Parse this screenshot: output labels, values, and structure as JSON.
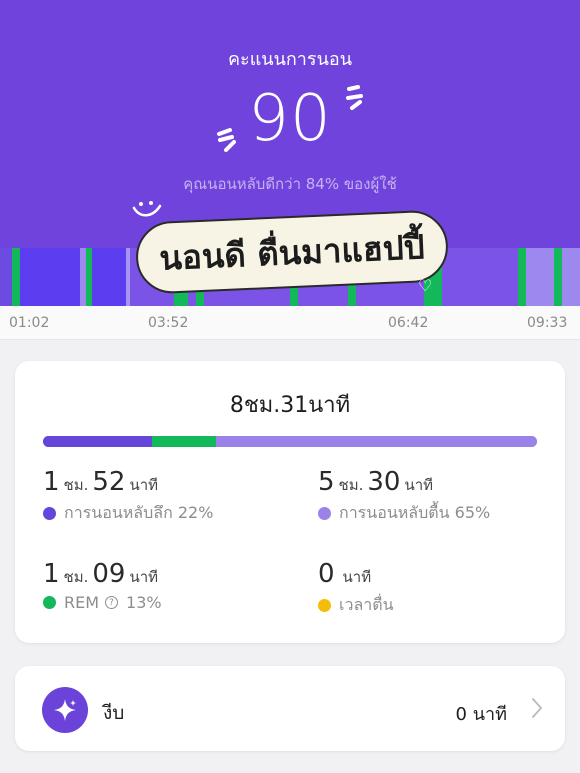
{
  "header": {
    "title": "คะแนนการนอน",
    "score": "90",
    "subtitle": "คุณนอนหลับดีกว่า 84% ของผู้ใช้"
  },
  "sticker": {
    "text": "นอนดี ตื่นมาแฮปปี้"
  },
  "axis": {
    "labels": [
      "01:02",
      "03:52",
      "06:42",
      "09:33"
    ]
  },
  "summary": {
    "total_hours": "8",
    "total_h_unit": "ชม.",
    "total_minutes": "31",
    "total_m_unit": "นาที",
    "proportions": {
      "deep": 0.22,
      "rem": 0.13,
      "light": 0.65
    },
    "stats": [
      {
        "hours": "1",
        "minutes": "52",
        "h_unit": "ชม.",
        "m_unit": "นาที",
        "label": "การนอนหลับลึก 22%",
        "color": "#6446d8"
      },
      {
        "hours": "5",
        "minutes": "30",
        "h_unit": "ชม.",
        "m_unit": "นาที",
        "label": "การนอนหลับตื้น 65%",
        "color": "#9a82e9"
      },
      {
        "hours": "1",
        "minutes": "09",
        "h_unit": "ชม.",
        "m_unit": "นาที",
        "label": "REM",
        "extra": "13%",
        "color": "#12b85a"
      },
      {
        "value": "0",
        "unit": "นาที",
        "label": "เวลาตื่น",
        "color": "#f5bd0b"
      }
    ]
  },
  "nap": {
    "label": "งีบ",
    "value": "0",
    "unit": "นาที"
  },
  "colors": {
    "header_bg": "#7044dc",
    "deep": "#6446d8",
    "light": "#9a82e9",
    "rem": "#12b85a",
    "awake": "#f5bd0b"
  }
}
